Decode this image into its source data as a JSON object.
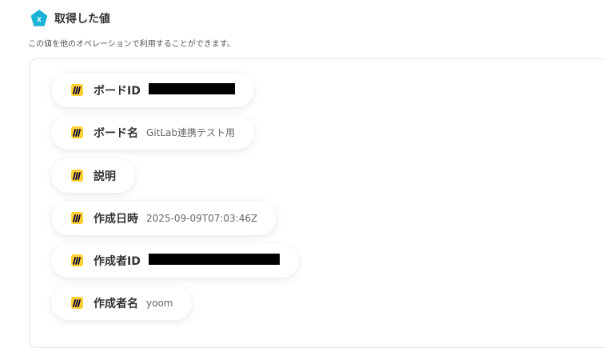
{
  "header": {
    "title": "取得した値",
    "icon": "variable-hexagon-icon",
    "icon_letter": "x",
    "accent_color": "#1ab3d6"
  },
  "subtitle": "この値を他のオペレーションで利用することができます。",
  "items": [
    {
      "label": "ボードID",
      "value": "",
      "redacted": true
    },
    {
      "label": "ボード名",
      "value": "GitLab連携テスト用",
      "redacted": false
    },
    {
      "label": "説明",
      "value": "",
      "redacted": false
    },
    {
      "label": "作成日時",
      "value": "2025-09-09T07:03:46Z",
      "redacted": false
    },
    {
      "label": "作成者ID",
      "value": "",
      "redacted": true
    },
    {
      "label": "作成者名",
      "value": "yoom",
      "redacted": false
    }
  ],
  "item_icon": "miro-icon",
  "item_icon_color": "#ffd02f"
}
